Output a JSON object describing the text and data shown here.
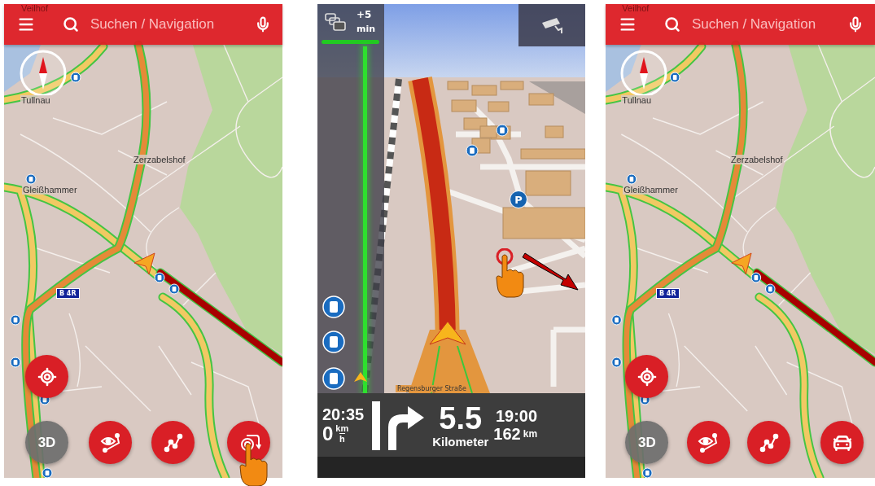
{
  "screens": [
    {
      "kind": "map",
      "search": {
        "placeholder": "Suchen / Navigation"
      },
      "map_labels": [
        "Veilhof",
        "Tullnau",
        "Zerzabelshof",
        "Gleißhammer"
      ],
      "road_badge": "B 4R",
      "tap_hint": true,
      "buttons": [
        {
          "kind": "locate"
        },
        {
          "kind": "view-3d",
          "label": "3D"
        },
        {
          "kind": "route-preview"
        },
        {
          "kind": "route"
        },
        {
          "kind": "touch-mode"
        }
      ]
    },
    {
      "kind": "navigation",
      "traffic_delay": {
        "value": "+5",
        "unit": "min"
      },
      "parking_sign": "P",
      "street": "Regensburger Straße",
      "tap_hint": true,
      "clock": "20:35",
      "speed": {
        "value": "0",
        "unit_top": "km",
        "unit_bottom": "h"
      },
      "distance": {
        "value": "5.5",
        "unit": "Kilometer"
      },
      "arrival": "19:00",
      "remaining": {
        "value": "162",
        "unit": "km"
      }
    },
    {
      "kind": "map",
      "search": {
        "placeholder": "Suchen / Navigation"
      },
      "map_labels": [
        "Veilhof",
        "Tullnau",
        "Zerzabelshof",
        "Gleißhammer"
      ],
      "road_badge": "B 4R",
      "tap_hint": false,
      "buttons": [
        {
          "kind": "locate"
        },
        {
          "kind": "view-3d",
          "label": "3D"
        },
        {
          "kind": "route-preview"
        },
        {
          "kind": "route"
        },
        {
          "kind": "car"
        }
      ]
    }
  ]
}
